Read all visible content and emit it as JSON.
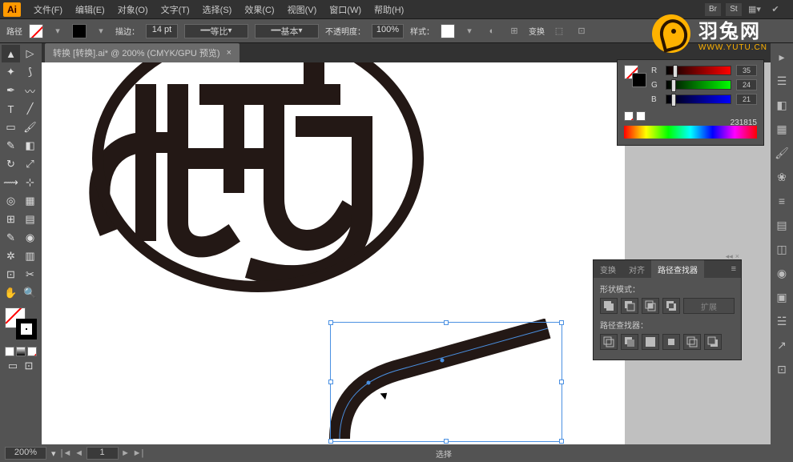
{
  "menu": {
    "file": "文件(F)",
    "edit": "编辑(E)",
    "object": "对象(O)",
    "type": "文字(T)",
    "select": "选择(S)",
    "effect": "效果(C)",
    "view": "视图(V)",
    "window": "窗口(W)",
    "help": "帮助(H)",
    "br": "Br",
    "st": "St"
  },
  "controlbar": {
    "label": "路径",
    "stroke_label": "描边：",
    "stroke_weight": "14 pt",
    "uniform": "等比",
    "basic": "基本",
    "opacity_label": "不透明度：",
    "opacity_value": "100%",
    "style_label": "样式：",
    "transform": "变换"
  },
  "document": {
    "tab_title": "转换  [转换].ai* @ 200% (CMYK/GPU 预览)"
  },
  "color_panel": {
    "r_label": "R",
    "g_label": "G",
    "b_label": "B",
    "r_value": "35",
    "g_value": "24",
    "b_value": "21",
    "hex_value": "231815"
  },
  "pathfinder": {
    "tab_transform": "变换",
    "tab_align": "对齐",
    "tab_pathfinder": "路径查找器",
    "shape_modes_label": "形状模式：",
    "expand_label": "扩展",
    "pathfinders_label": "路径查找器："
  },
  "status": {
    "zoom": "200%",
    "page": "1",
    "selection": "选择"
  },
  "watermark": {
    "cn": "羽兔网",
    "en": "WWW.YUTU.CN"
  },
  "icons": {
    "close": "×",
    "dropdown": "▾",
    "menu_lines": "≡",
    "arrow_l": "◄",
    "arrow_r": "►",
    "arrow_ll": "|◄",
    "arrow_rr": "►|",
    "search": "⌕"
  }
}
